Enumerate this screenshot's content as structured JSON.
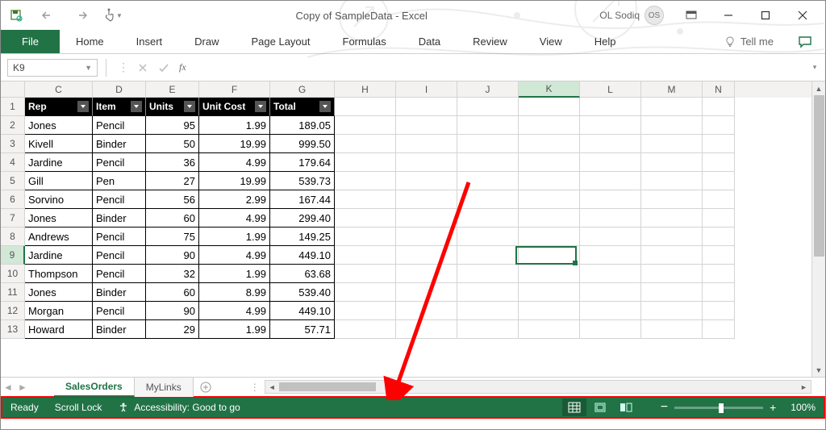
{
  "window": {
    "title": "Copy of SampleData  -  Excel",
    "user_name": "OL Sodiq",
    "user_initials": "OS"
  },
  "ribbon": {
    "file": "File",
    "tabs": [
      "Home",
      "Insert",
      "Draw",
      "Page Layout",
      "Formulas",
      "Data",
      "Review",
      "View",
      "Help"
    ],
    "tell_me": "Tell me"
  },
  "formula_bar": {
    "name_box": "K9",
    "formula": ""
  },
  "grid": {
    "columns": [
      "C",
      "D",
      "E",
      "F",
      "G",
      "H",
      "I",
      "J",
      "K",
      "L",
      "M",
      "N"
    ],
    "selected_col": "K",
    "selected_row": 9,
    "row_start": 1,
    "row_end": 13,
    "headers": {
      "C": "Rep",
      "D": "Item",
      "E": "Units",
      "F": "Unit Cost",
      "G": "Total"
    },
    "rows": [
      {
        "n": 2,
        "C": "Jones",
        "D": "Pencil",
        "E": "95",
        "F": "1.99",
        "G": "189.05"
      },
      {
        "n": 3,
        "C": "Kivell",
        "D": "Binder",
        "E": "50",
        "F": "19.99",
        "G": "999.50"
      },
      {
        "n": 4,
        "C": "Jardine",
        "D": "Pencil",
        "E": "36",
        "F": "4.99",
        "G": "179.64"
      },
      {
        "n": 5,
        "C": "Gill",
        "D": "Pen",
        "E": "27",
        "F": "19.99",
        "G": "539.73"
      },
      {
        "n": 6,
        "C": "Sorvino",
        "D": "Pencil",
        "E": "56",
        "F": "2.99",
        "G": "167.44"
      },
      {
        "n": 7,
        "C": "Jones",
        "D": "Binder",
        "E": "60",
        "F": "4.99",
        "G": "299.40"
      },
      {
        "n": 8,
        "C": "Andrews",
        "D": "Pencil",
        "E": "75",
        "F": "1.99",
        "G": "149.25"
      },
      {
        "n": 9,
        "C": "Jardine",
        "D": "Pencil",
        "E": "90",
        "F": "4.99",
        "G": "449.10"
      },
      {
        "n": 10,
        "C": "Thompson",
        "D": "Pencil",
        "E": "32",
        "F": "1.99",
        "G": "63.68"
      },
      {
        "n": 11,
        "C": "Jones",
        "D": "Binder",
        "E": "60",
        "F": "8.99",
        "G": "539.40"
      },
      {
        "n": 12,
        "C": "Morgan",
        "D": "Pencil",
        "E": "90",
        "F": "4.99",
        "G": "449.10"
      },
      {
        "n": 13,
        "C": "Howard",
        "D": "Binder",
        "E": "29",
        "F": "1.99",
        "G": "57.71"
      }
    ]
  },
  "sheets": {
    "tabs": [
      "SalesOrders",
      "MyLinks"
    ],
    "active": 0
  },
  "status": {
    "mode": "Ready",
    "scroll_lock": "Scroll Lock",
    "accessibility": "Accessibility: Good to go",
    "zoom": "100%"
  }
}
